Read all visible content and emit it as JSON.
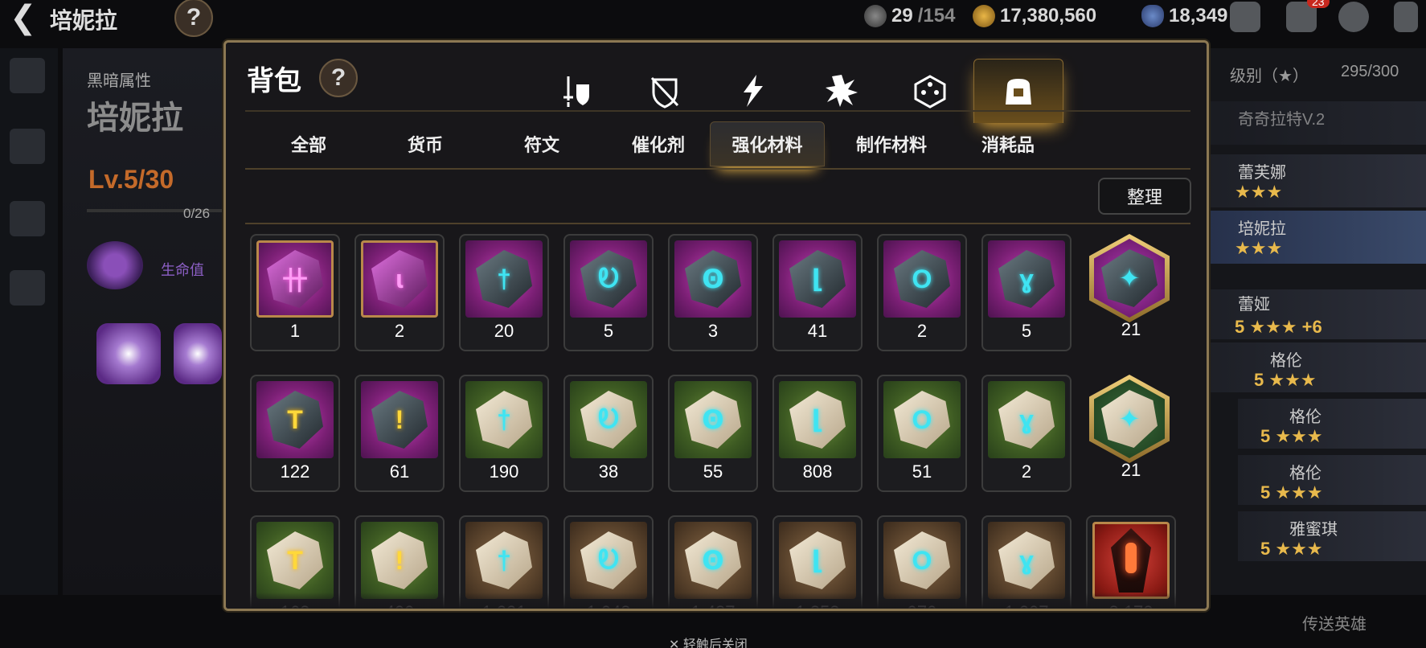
{
  "topbar": {
    "hero_name": "培妮拉",
    "stamina": "29",
    "stamina_max": "/154",
    "gold": "17,380,560",
    "crystals": "18,349",
    "mail_badge": "23"
  },
  "hero_panel": {
    "attribute": "黑暗属性",
    "name": "培妮拉",
    "level": "Lv.5/30",
    "exp": "0/26",
    "stat_label": "生命值"
  },
  "right_list": {
    "sort_label": "级别（★）",
    "count": "295/300",
    "heroes": [
      {
        "name": "奇奇拉特V.2",
        "stars": ""
      },
      {
        "name": "蕾芙娜",
        "stars": "★★★"
      },
      {
        "name": "培妮拉",
        "stars": "★★★"
      },
      {
        "name": "蕾娅",
        "stars": "5 ★★★ +6"
      },
      {
        "name": "格伦",
        "stars": "5 ★★★"
      },
      {
        "name": "格伦",
        "stars": "5 ★★★"
      },
      {
        "name": "格伦",
        "stars": "5 ★★★"
      },
      {
        "name": "雅蜜琪",
        "stars": "5 ★★★"
      }
    ],
    "transfer": "传送英雄"
  },
  "close_hint": "✕ 轻触后关闭",
  "modal": {
    "title": "背包",
    "help": "?",
    "category_icons": [
      "sword-shield-icon",
      "broken-shield-icon",
      "lightning-icon",
      "burst-icon",
      "dice-icon",
      "backpack-icon",
      "house-icon"
    ],
    "active_category": 5,
    "subtabs": [
      "全部",
      "货币",
      "符文",
      "催化剂",
      "强化材料",
      "制作材料",
      "消耗品"
    ],
    "active_subtab": 4,
    "sort_button": "整理",
    "items": [
      {
        "qty": "1",
        "icon": "hammer-rune-icon",
        "bg": "purple-gold",
        "stone": "amethyst",
        "glyph": "卄",
        "gc": "pink"
      },
      {
        "qty": "2",
        "icon": "broken-rune-icon",
        "bg": "purple-gold",
        "stone": "amethyst",
        "glyph": "ɩ",
        "gc": "pink"
      },
      {
        "qty": "20",
        "icon": "sword-rune-icon",
        "bg": "purple",
        "stone": "dark",
        "glyph": "†",
        "gc": "cyan"
      },
      {
        "qty": "5",
        "icon": "helm-rune-icon",
        "bg": "purple",
        "stone": "dark",
        "glyph": "Ꭷ",
        "gc": "cyan"
      },
      {
        "qty": "3",
        "icon": "armor-rune-icon",
        "bg": "purple",
        "stone": "dark",
        "glyph": "Ꙩ",
        "gc": "cyan"
      },
      {
        "qty": "41",
        "icon": "boot-rune-icon",
        "bg": "purple",
        "stone": "dark",
        "glyph": "⌊",
        "gc": "cyan"
      },
      {
        "qty": "2",
        "icon": "ring-rune-icon",
        "bg": "purple",
        "stone": "dark",
        "glyph": "O",
        "gc": "cyan"
      },
      {
        "qty": "5",
        "icon": "necklace-rune-icon",
        "bg": "purple",
        "stone": "dark",
        "glyph": "ɣ",
        "gc": "cyan"
      },
      {
        "qty": "21",
        "icon": "epic-star-rune-icon",
        "bg": "hex-purple",
        "stone": "dark",
        "glyph": "✦",
        "gc": "cyan"
      },
      {
        "qty": "122",
        "icon": "gold-hammer-rune-icon",
        "bg": "purple",
        "stone": "dark",
        "glyph": "T",
        "gc": "gold"
      },
      {
        "qty": "61",
        "icon": "gold-broken-rune-icon",
        "bg": "purple",
        "stone": "dark",
        "glyph": "!",
        "gc": "gold"
      },
      {
        "qty": "190",
        "icon": "pale-sword-rune-icon",
        "bg": "green",
        "stone": "pale",
        "glyph": "†",
        "gc": "cyan"
      },
      {
        "qty": "38",
        "icon": "pale-helm-rune-icon",
        "bg": "green",
        "stone": "pale",
        "glyph": "Ꭷ",
        "gc": "cyan"
      },
      {
        "qty": "55",
        "icon": "pale-armor-rune-icon",
        "bg": "green",
        "stone": "pale",
        "glyph": "Ꙩ",
        "gc": "cyan"
      },
      {
        "qty": "808",
        "icon": "pale-boot-rune-icon",
        "bg": "green",
        "stone": "pale",
        "glyph": "⌊",
        "gc": "cyan"
      },
      {
        "qty": "51",
        "icon": "pale-ring-rune-icon",
        "bg": "green",
        "stone": "pale",
        "glyph": "O",
        "gc": "cyan"
      },
      {
        "qty": "2",
        "icon": "pale-necklace-rune-icon",
        "bg": "green",
        "stone": "pale",
        "glyph": "ɣ",
        "gc": "cyan"
      },
      {
        "qty": "21",
        "icon": "rare-star-rune-icon",
        "bg": "hex-green",
        "stone": "pale",
        "glyph": "✦",
        "gc": "cyan"
      },
      {
        "qty": "163",
        "icon": "pale-hammer-rune-icon",
        "bg": "green",
        "stone": "pale",
        "glyph": "T",
        "gc": "gold"
      },
      {
        "qty": "400",
        "icon": "pale-broken-rune-icon",
        "bg": "green",
        "stone": "pale",
        "glyph": "!",
        "gc": "gold"
      },
      {
        "qty": "1,221",
        "icon": "paper-sword-rune-icon",
        "bg": "brown",
        "stone": "pale",
        "glyph": "†",
        "gc": "cyan"
      },
      {
        "qty": "1,048",
        "icon": "paper-helm-rune-icon",
        "bg": "brown",
        "stone": "pale",
        "glyph": "Ꭷ",
        "gc": "cyan"
      },
      {
        "qty": "1,487",
        "icon": "paper-armor-rune-icon",
        "bg": "brown",
        "stone": "pale",
        "glyph": "Ꙩ",
        "gc": "cyan"
      },
      {
        "qty": "1,353",
        "icon": "paper-boot-rune-icon",
        "bg": "brown",
        "stone": "pale",
        "glyph": "⌊",
        "gc": "cyan"
      },
      {
        "qty": "970",
        "icon": "paper-ring-rune-icon",
        "bg": "brown",
        "stone": "pale",
        "glyph": "O",
        "gc": "cyan"
      },
      {
        "qty": "1,207",
        "icon": "paper-necklace-rune-icon",
        "bg": "brown",
        "stone": "pale",
        "glyph": "ɣ",
        "gc": "cyan"
      },
      {
        "qty": "8,172",
        "icon": "red-crystal-icon",
        "bg": "red",
        "stone": "crystal",
        "glyph": "",
        "gc": "cyan"
      }
    ]
  }
}
